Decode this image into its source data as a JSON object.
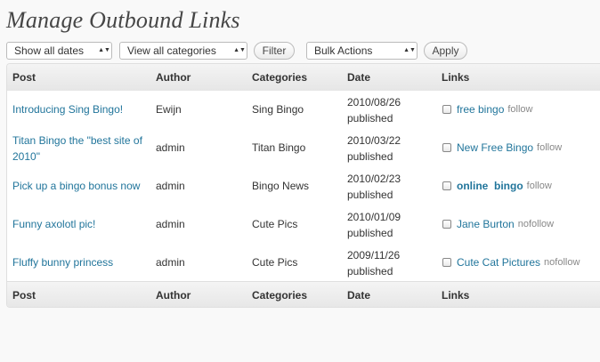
{
  "page": {
    "title": "Manage Outbound Links"
  },
  "filters": {
    "dates": {
      "selected": "Show all dates"
    },
    "categories": {
      "selected": "View all categories"
    },
    "filter_label": "Filter",
    "bulk": {
      "selected": "Bulk Actions"
    },
    "apply_label": "Apply"
  },
  "table": {
    "columns": [
      "Post",
      "Author",
      "Categories",
      "Date",
      "Links"
    ],
    "rows": [
      {
        "post": "Introducing Sing Bingo!",
        "author": "Ewijn",
        "category": "Sing Bingo",
        "date": "2010/08/26",
        "status": "published",
        "link": "free bingo",
        "link_bold": false,
        "rel": "follow"
      },
      {
        "post": "Titan Bingo the \"best site of 2010\"",
        "author": "admin",
        "category": "Titan Bingo",
        "date": "2010/03/22",
        "status": "published",
        "link": "New Free Bingo",
        "link_bold": false,
        "rel": "follow"
      },
      {
        "post": "Pick up a bingo bonus now",
        "author": "admin",
        "category": "Bingo News",
        "date": "2010/02/23",
        "status": "published",
        "link": "online  bingo",
        "link_bold": true,
        "rel": "follow"
      },
      {
        "post": "Funny axolotl pic!",
        "author": "admin",
        "category": "Cute Pics",
        "date": "2010/01/09",
        "status": "published",
        "link": "Jane Burton",
        "link_bold": false,
        "rel": "nofollow"
      },
      {
        "post": "Fluffy bunny princess",
        "author": "admin",
        "category": "Cute Pics",
        "date": "2009/11/26",
        "status": "published",
        "link": "Cute Cat Pictures",
        "link_bold": false,
        "rel": "nofollow"
      }
    ]
  },
  "colors": {
    "link": "#21759b",
    "header_bg": "#ececec",
    "muted": "#888888"
  }
}
